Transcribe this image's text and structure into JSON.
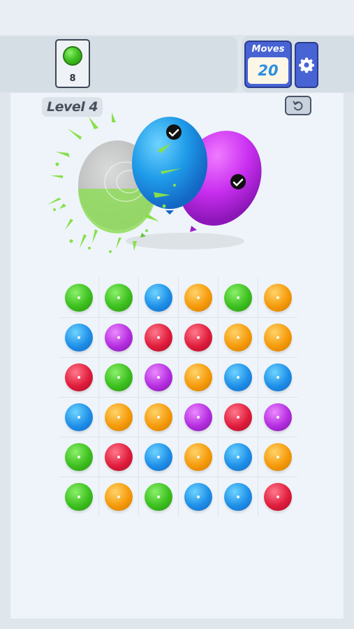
{
  "header": {
    "goal": {
      "color": "green",
      "count": "8"
    },
    "moves": {
      "label": "Moves",
      "value": "20"
    },
    "settings_icon": "gear-icon"
  },
  "level": {
    "label": "Level 4"
  },
  "undo_icon": "undo-icon",
  "balloons": [
    {
      "color": "green",
      "state": "popped"
    },
    {
      "color": "blue",
      "state": "matched"
    },
    {
      "color": "purple",
      "state": "matched"
    }
  ],
  "colors": {
    "green": "#3cbf1e",
    "blue": "#1e8fe8",
    "red": "#e01c3c",
    "orange": "#f59a0a",
    "purple": "#b52ee0",
    "accent": "#4763d4"
  },
  "grid": [
    [
      "green",
      "green",
      "blue",
      "orange",
      "green",
      "orange"
    ],
    [
      "blue",
      "purple",
      "red",
      "red",
      "orange",
      "orange"
    ],
    [
      "red",
      "green",
      "purple",
      "orange",
      "blue",
      "blue"
    ],
    [
      "blue",
      "orange",
      "orange",
      "purple",
      "red",
      "purple"
    ],
    [
      "green",
      "red",
      "blue",
      "orange",
      "blue",
      "orange"
    ],
    [
      "green",
      "orange",
      "green",
      "blue",
      "blue",
      "red"
    ]
  ]
}
